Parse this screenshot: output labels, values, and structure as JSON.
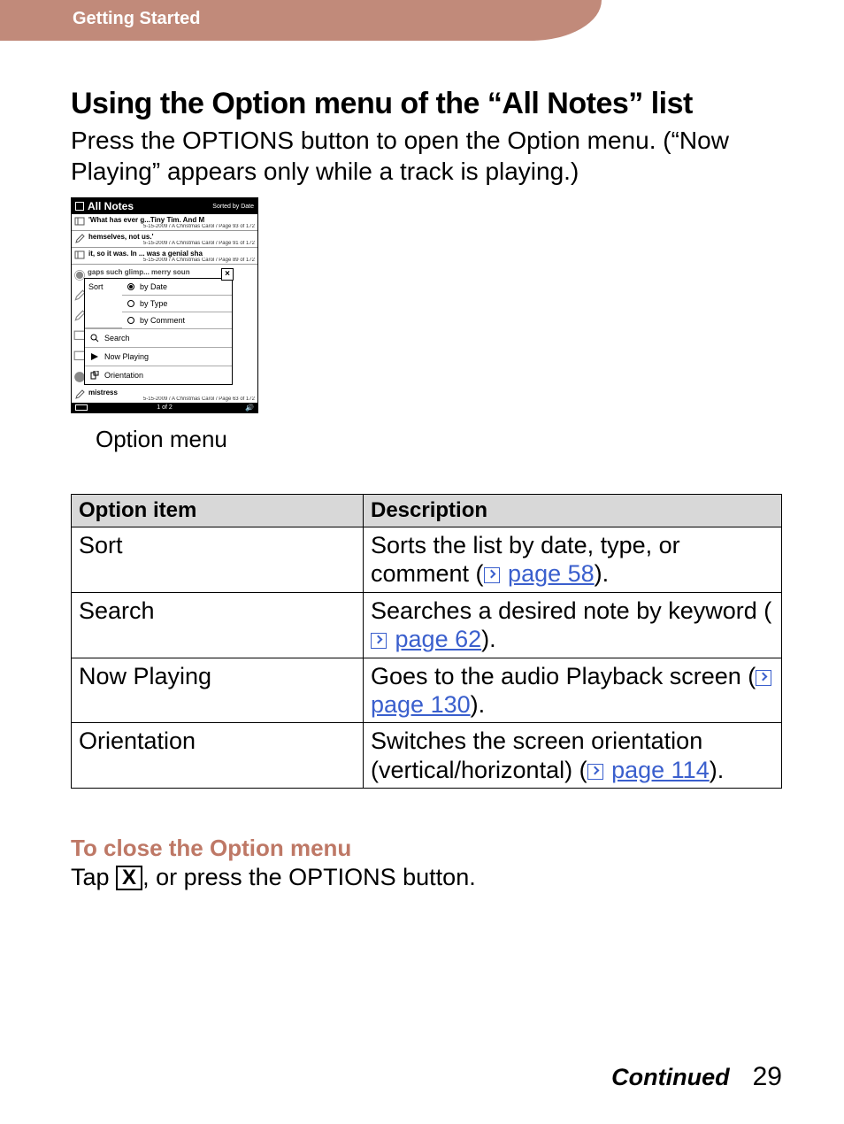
{
  "header": {
    "section": "Getting Started"
  },
  "title": "Using the Option menu of the “All Notes” list",
  "intro": "Press the OPTIONS button to open the Option menu. (“Now Playing” appears only while a track is playing.)",
  "screenshot": {
    "title": "All Notes",
    "sorted": "Sorted by Date",
    "rows_top": [
      {
        "icon": "bookmark",
        "line1": "'What has ever g...Tiny Tim. And M",
        "line2": "5-15-2009 / A Christmas Carol / Page 93 of 172"
      },
      {
        "icon": "pencil",
        "line1": "hemselves, not us.'",
        "line2": "5-15-2009 / A Christmas Carol / Page 91 of 172"
      },
      {
        "icon": "bookmark",
        "line1": "it, so it was. In ... was a genial sha",
        "line2": "5-15-2009 / A Christmas Carol / Page 89 of 172"
      }
    ],
    "dim_rows": [
      {
        "icon": "clock",
        "text": "gaps such glimp... merry soun"
      },
      {
        "icon": "pencil",
        "text": ""
      },
      {
        "icon": "pencil",
        "text": ""
      },
      {
        "icon": "bookmark",
        "text": ""
      },
      {
        "icon": "bookmark",
        "text": ""
      },
      {
        "icon": "clock",
        "text": ""
      }
    ],
    "popup": {
      "close": "×",
      "sort_label": "Sort",
      "sort_options": [
        {
          "label": "by Date",
          "selected": true
        },
        {
          "label": "by Type",
          "selected": false
        },
        {
          "label": "by Comment",
          "selected": false
        }
      ],
      "menu": [
        {
          "icon": "search",
          "label": "Search"
        },
        {
          "icon": "play",
          "label": "Now Playing"
        },
        {
          "icon": "orient",
          "label": "Orientation"
        }
      ]
    },
    "row_bottom": {
      "icon": "pencil",
      "line1": "mistress",
      "line2": "5-15-2009 / A Christmas Carol / Page 63 of 172"
    },
    "footer_page": "1 of 2"
  },
  "caption": "Option menu",
  "table": {
    "headers": {
      "item": "Option item",
      "desc": "Description"
    },
    "rows": [
      {
        "item": "Sort",
        "desc_a": "Sorts the list by date, type, or comment (",
        "link": "page 58",
        "desc_b": ")."
      },
      {
        "item": "Search",
        "desc_a": "Searches a desired note by keyword (",
        "link": "page 62",
        "desc_b": ")."
      },
      {
        "item": "Now Playing",
        "desc_a": "Goes to the audio Playback screen (",
        "link": "page 130",
        "desc_b": ")."
      },
      {
        "item": "Orientation",
        "desc_a": "Switches the screen orientation (vertical/horizontal) (",
        "link": "page 114",
        "desc_b": ")."
      }
    ]
  },
  "close_heading": "To close the Option menu",
  "close_text_a": "Tap ",
  "close_x": "X",
  "close_text_b": ", or press the OPTIONS button.",
  "footer": {
    "continued": "Continued",
    "page": "29"
  }
}
